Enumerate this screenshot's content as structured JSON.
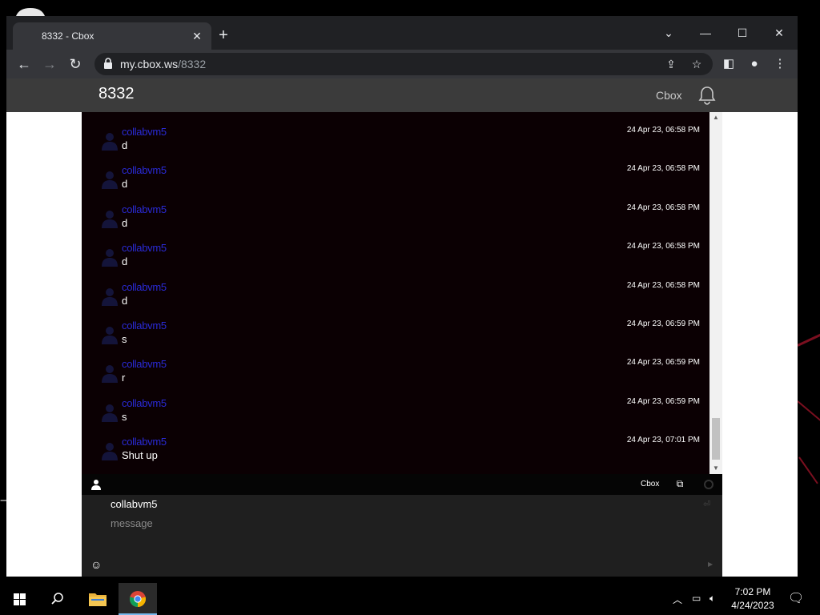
{
  "browser": {
    "tab_title": "8332 - Cbox",
    "tab_close": "✕",
    "new_tab": "+",
    "window_controls": {
      "tab_search": "⌄",
      "minimize": "—",
      "maximize": "☐",
      "close": "✕"
    },
    "url_host": "my.cbox.ws",
    "url_path": "/8332"
  },
  "page": {
    "box_id": "8332",
    "brand_link": "Cbox"
  },
  "chat": {
    "messages": [
      {
        "user": "collabvm5",
        "text": "d",
        "time": "24 Apr 23, 06:58 PM"
      },
      {
        "user": "collabvm5",
        "text": "d",
        "time": "24 Apr 23, 06:58 PM"
      },
      {
        "user": "collabvm5",
        "text": "d",
        "time": "24 Apr 23, 06:58 PM"
      },
      {
        "user": "collabvm5",
        "text": "d",
        "time": "24 Apr 23, 06:58 PM"
      },
      {
        "user": "collabvm5",
        "text": "d",
        "time": "24 Apr 23, 06:58 PM"
      },
      {
        "user": "collabvm5",
        "text": "s",
        "time": "24 Apr 23, 06:59 PM"
      },
      {
        "user": "collabvm5",
        "text": "r",
        "time": "24 Apr 23, 06:59 PM"
      },
      {
        "user": "collabvm5",
        "text": "s",
        "time": "24 Apr 23, 06:59 PM"
      },
      {
        "user": "collabvm5",
        "text": "Shut up",
        "time": "24 Apr 23, 07:01 PM"
      }
    ],
    "bar_brand": "Cbox",
    "compose_name": "collabvm5",
    "message_placeholder": "message",
    "message_value": ""
  },
  "taskbar": {
    "time": "7:02 PM",
    "date": "4/24/2023"
  },
  "colors": {
    "username": "#2a2ad6",
    "chat_background": "#0b0003",
    "header_background": "#3b3b3b"
  }
}
